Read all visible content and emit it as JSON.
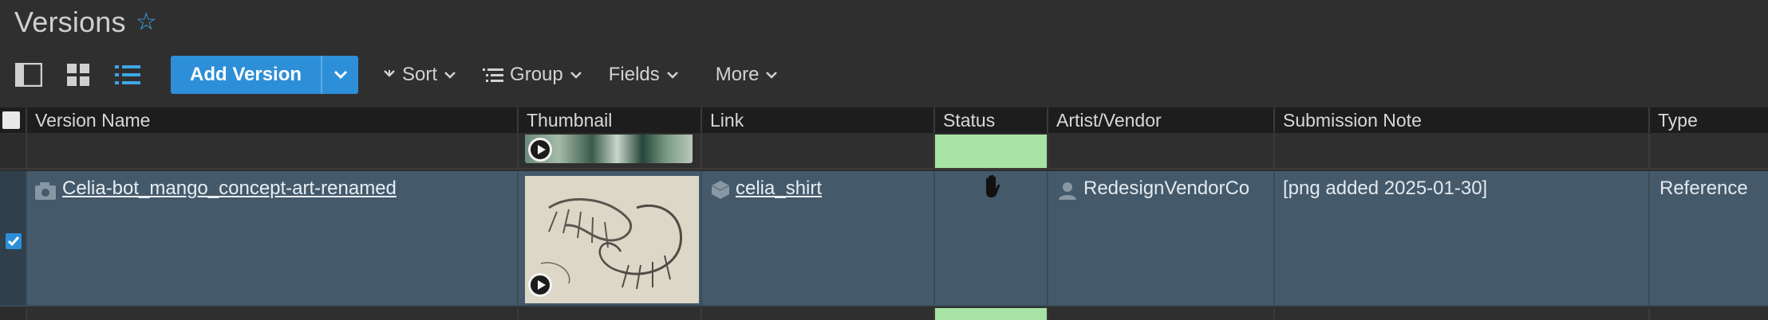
{
  "page": {
    "title": "Versions",
    "favorite_icon": "star-outline-icon"
  },
  "toolbar": {
    "view_icons": [
      "sidebar-layout-icon",
      "grid-view-icon",
      "list-view-icon"
    ],
    "add_version_label": "Add Version",
    "sort_label": "Sort",
    "group_label": "Group",
    "fields_label": "Fields",
    "more_label": "More"
  },
  "table": {
    "columns": [
      "Version Name",
      "Thumbnail",
      "Link",
      "Status",
      "Artist/Vendor",
      "Submission Note",
      "Type"
    ],
    "rows": [
      {
        "version_name": "",
        "link": "",
        "status_color": "#a7e3a4",
        "artist": "",
        "note": "",
        "type": ""
      },
      {
        "selected": true,
        "version_name": "Celia-bot_mango_concept-art-renamed",
        "link": "celia_shirt",
        "status_icon": "hand-icon",
        "artist": "RedesignVendorCo",
        "note": "[png added 2025-01-30]",
        "type": "Reference"
      }
    ]
  },
  "colors": {
    "accent": "#2d8fd8",
    "selected_row": "#445a6b",
    "status_green": "#a7e3a4",
    "header_bg": "#1d1d1d",
    "page_bg": "#2f2f2f"
  }
}
